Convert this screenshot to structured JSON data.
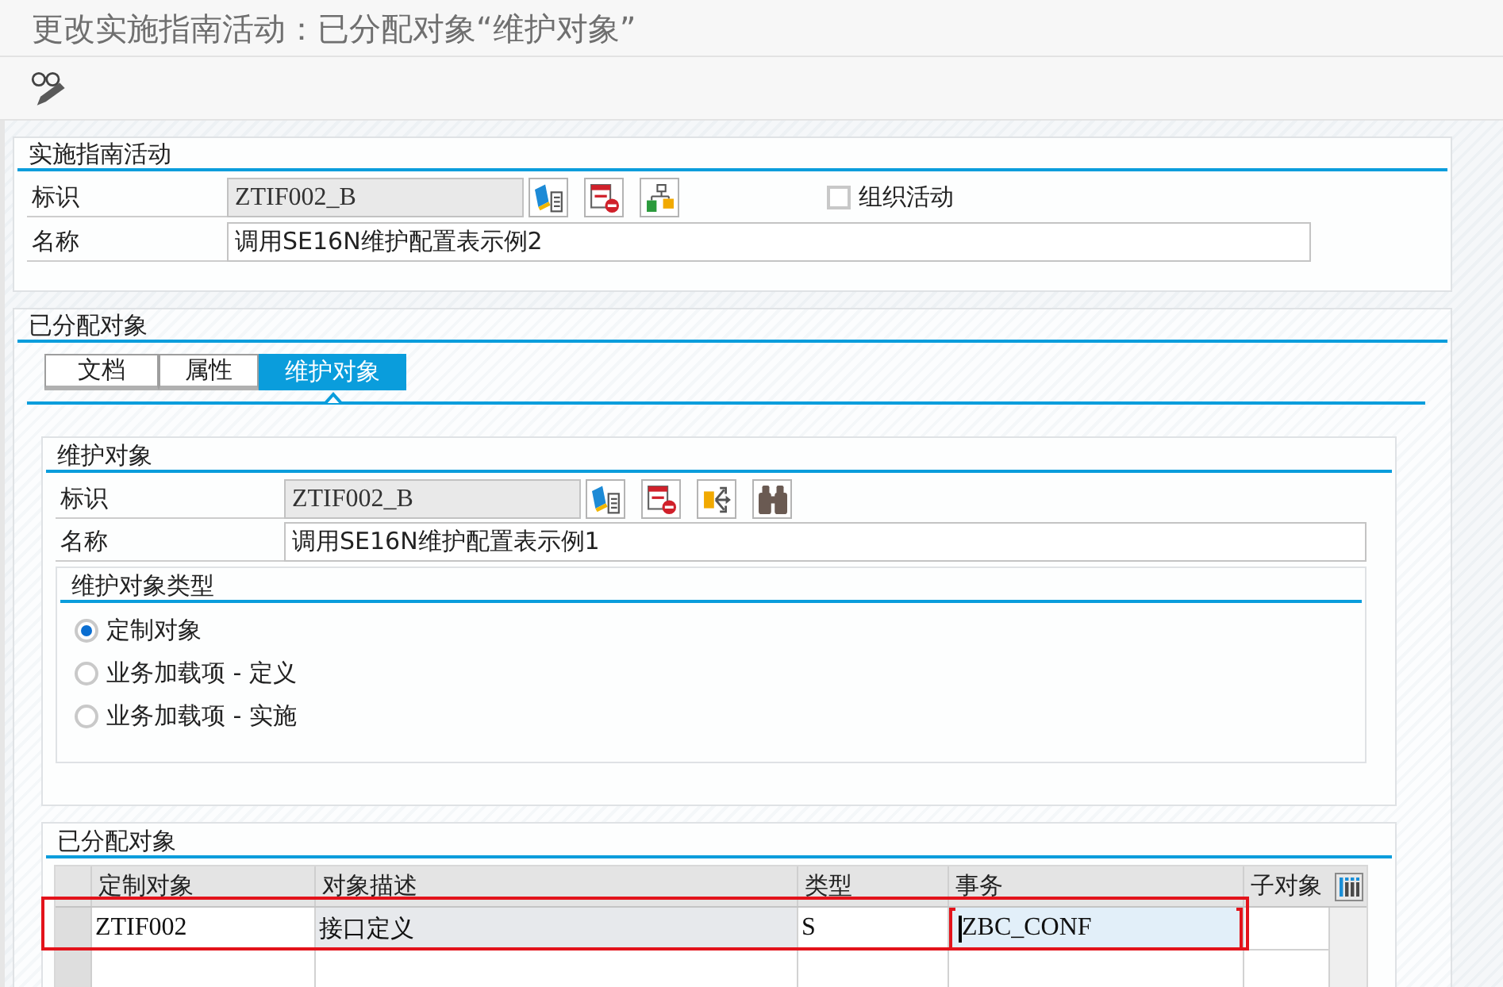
{
  "window": {
    "title": "更改实施指南活动：已分配对象“维护对象”"
  },
  "activity": {
    "title": "实施指南活动",
    "id": {
      "label": "标识",
      "value": "ZTIF002_B"
    },
    "buttons": [
      {
        "kind": "notebook"
      },
      {
        "kind": "delete"
      },
      {
        "kind": "hierarchy"
      }
    ],
    "org_activity": {
      "label": "组织活动",
      "checked": false
    },
    "name": {
      "label": "名称",
      "value": "调用SE16N维护配置表示例2"
    }
  },
  "assigned": {
    "title": "已分配对象",
    "tabs": [
      {
        "label": "文档",
        "selected": false
      },
      {
        "label": "属性",
        "selected": false
      },
      {
        "label": "维护对象",
        "selected": true
      }
    ],
    "maintenance_object": {
      "title": "维护对象",
      "id": {
        "label": "标识",
        "value": "ZTIF002_B"
      },
      "buttons": [
        {
          "kind": "notebook"
        },
        {
          "kind": "delete"
        },
        {
          "kind": "branch"
        },
        {
          "kind": "find"
        }
      ],
      "name": {
        "label": "名称",
        "value": "调用SE16N维护配置表示例1"
      },
      "object_type": {
        "title": "维护对象类型",
        "options": [
          {
            "label": "定制对象",
            "selected": true
          },
          {
            "label": "业务加载项 - 定义",
            "selected": false
          },
          {
            "label": "业务加载项 - 实施",
            "selected": false
          }
        ]
      }
    },
    "assigned_objects": {
      "title": "已分配对象",
      "columns": [
        "定制对象",
        "对象描述",
        "类型",
        "事务",
        "子对象"
      ],
      "rows": [
        {
          "highlighted": true,
          "cells": [
            {
              "text": "ZTIF002",
              "editable": true,
              "focused": false
            },
            {
              "text": "接口定义",
              "editable": false,
              "focused": false
            },
            {
              "text": "S",
              "editable": true,
              "focused": false
            },
            {
              "text": "ZBC_CONF",
              "editable": true,
              "focused": true
            }
          ]
        }
      ]
    }
  }
}
